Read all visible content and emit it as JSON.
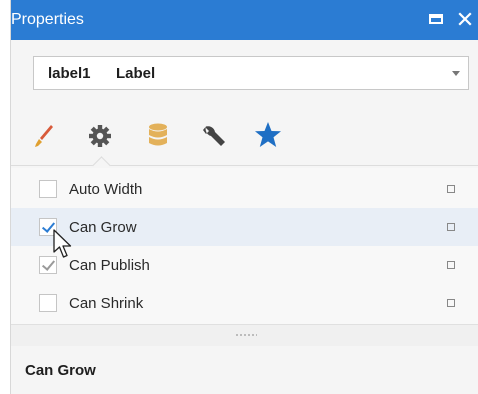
{
  "panel": {
    "title": "Properties",
    "accent": "#2b7cd3"
  },
  "selector": {
    "name": "label1",
    "type": "Label"
  },
  "tabs": [
    {
      "icon": "brush-icon"
    },
    {
      "icon": "gear-icon"
    },
    {
      "icon": "database-icon"
    },
    {
      "icon": "wrench-icon"
    },
    {
      "icon": "star-icon"
    }
  ],
  "properties": [
    {
      "label": "Auto Width",
      "checked": false
    },
    {
      "label": "Can Grow",
      "checked": true
    },
    {
      "label": "Can Publish",
      "checked": true
    },
    {
      "label": "Can Shrink",
      "checked": false
    }
  ],
  "description": {
    "title": "Can Grow"
  }
}
